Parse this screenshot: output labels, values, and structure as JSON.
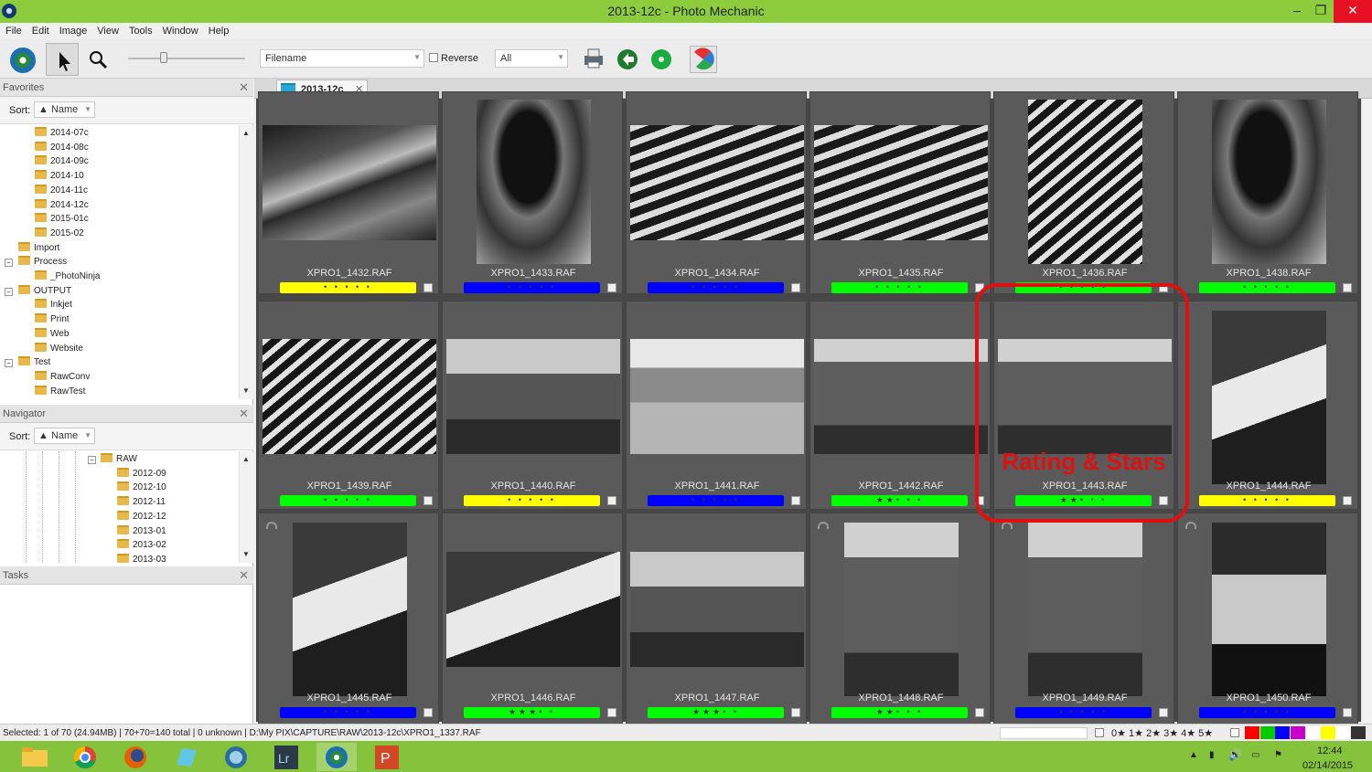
{
  "window": {
    "title": "2013-12c - Photo Mechanic"
  },
  "menu": [
    "File",
    "Edit",
    "Image",
    "View",
    "Tools",
    "Window",
    "Help"
  ],
  "toolbar": {
    "sort_field": "Filename",
    "reverse_label": "Reverse",
    "filter_value": "All"
  },
  "favorites": {
    "title": "Favorites",
    "sort_label": "Sort:",
    "sort_value": "▲ Name",
    "items": [
      "2014-07c",
      "2014-08c",
      "2014-09c",
      "2014-10",
      "2014-11c",
      "2014-12c",
      "2015-01c",
      "2015-02",
      "Import",
      "Process",
      "_PhotoNinja",
      "OUTPUT",
      "Inkjet",
      "Print",
      "Web",
      "Website",
      "Test",
      "RawConv",
      "RawTest"
    ]
  },
  "navigator": {
    "title": "Navigator",
    "sort_label": "Sort:",
    "sort_value": "▲ Name",
    "items": [
      "RAW",
      "2012-09",
      "2012-10",
      "2012-11",
      "2012-12",
      "2013-01",
      "2013-02",
      "2013-03"
    ]
  },
  "tasks": {
    "title": "Tasks"
  },
  "tab": {
    "label": "2013-12c"
  },
  "thumbnails": [
    {
      "file": "XPRO1_1432.RAF",
      "color": "#ffff00",
      "stars": "• • • • •"
    },
    {
      "file": "XPRO1_1433.RAF",
      "color": "#0000ff",
      "stars": "• • • • •"
    },
    {
      "file": "XPRO1_1434.RAF",
      "color": "#0000ff",
      "stars": "• • • • •"
    },
    {
      "file": "XPRO1_1435.RAF",
      "color": "#00ff00",
      "stars": "• • • • •"
    },
    {
      "file": "XPRO1_1436.RAF",
      "color": "#00ff00",
      "stars": "• • • • •"
    },
    {
      "file": "XPRO1_1438.RAF",
      "color": "#00ff00",
      "stars": "• • • • •"
    },
    {
      "file": "XPRO1_1439.RAF",
      "color": "#00ff00",
      "stars": "• • • • •"
    },
    {
      "file": "XPRO1_1440.RAF",
      "color": "#ffff00",
      "stars": "• • • • •"
    },
    {
      "file": "XPRO1_1441.RAF",
      "color": "#0000ff",
      "stars": "• • • • •"
    },
    {
      "file": "XPRO1_1442.RAF",
      "color": "#00ff00",
      "stars": "★★• • •"
    },
    {
      "file": "XPRO1_1443.RAF",
      "color": "#00ff00",
      "stars": "★★• • •"
    },
    {
      "file": "XPRO1_1444.RAF",
      "color": "#ffff00",
      "stars": "• • • • •"
    },
    {
      "file": "XPRO1_1445.RAF",
      "color": "#0000ff",
      "stars": "• • • • •"
    },
    {
      "file": "XPRO1_1446.RAF",
      "color": "#00ff00",
      "stars": "★★★• •"
    },
    {
      "file": "XPRO1_1447.RAF",
      "color": "#00ff00",
      "stars": "★★★• •"
    },
    {
      "file": "XPRO1_1448.RAF",
      "color": "#00ff00",
      "stars": "★★• • •"
    },
    {
      "file": "XPRO1_1449.RAF",
      "color": "#0000ff",
      "stars": "• • • • •"
    },
    {
      "file": "XPRO1_1450.RAF",
      "color": "#0000ff",
      "stars": "• • • • •"
    }
  ],
  "annotation": {
    "text": "Rating & Stars",
    "color": "#e01010"
  },
  "status": {
    "text": "Selected: 1 of 70 (24.94MB) | 70+70=140 total | 0 unknown | D:\\My PIX\\CAPTURE\\RAW\\2013-12c\\XPRO1_1337.RAF",
    "stars_filter": "0★ 1★ 2★ 3★ 4★ 5★",
    "swatches": [
      "#ff0000",
      "#00cc00",
      "#0000ff",
      "#cc00cc",
      "#ffffff",
      "#ffff00",
      "#ffffff",
      "#333333"
    ]
  },
  "taskbar": {
    "time": "12:44",
    "date": "02/14/2015"
  }
}
